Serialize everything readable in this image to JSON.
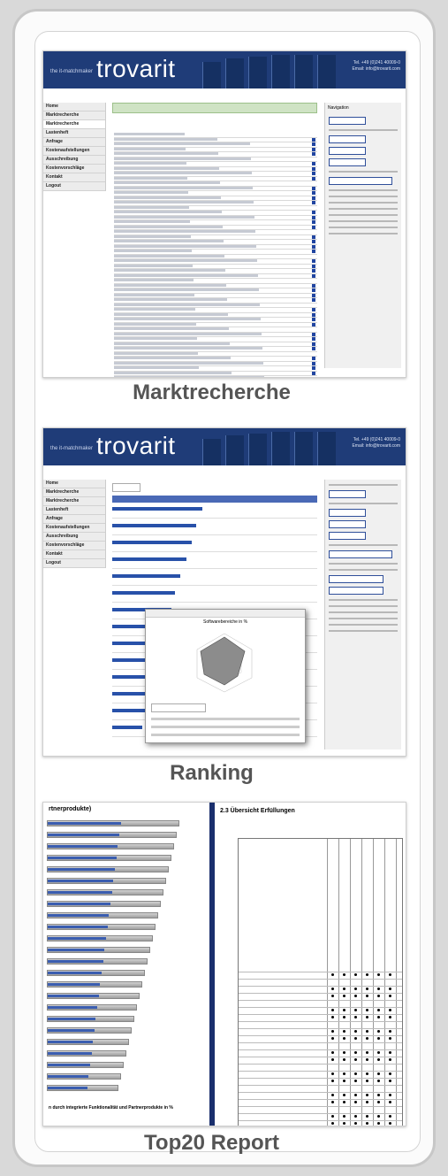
{
  "captions": {
    "marktrecherche": "Marktrecherche",
    "ranking": "Ranking",
    "top20": "Top20 Report"
  },
  "screen1": {
    "logo_prefix": "the it-matchmaker",
    "logo": "trovarit",
    "sidebar": [
      "Home",
      "Marktrecherche",
      "Marktrecherche",
      "Lastenheft",
      "Anfrage",
      "Kostenaufstellungen",
      "Ausschreibung",
      "Kostenvorschläge",
      "Kontakt",
      "Logout"
    ],
    "right_title": "Navigation"
  },
  "screen2": {
    "logo_prefix": "the it-matchmaker",
    "logo": "trovarit",
    "popup_title": "Softwarebereiche in %"
  },
  "screen3": {
    "left_title": "rtnerprodukte)",
    "right_title": "2.3   Übersicht Erfüllungen",
    "footer_text": "n durch integrierte Funktionalität und Partnerprodukte in %"
  }
}
